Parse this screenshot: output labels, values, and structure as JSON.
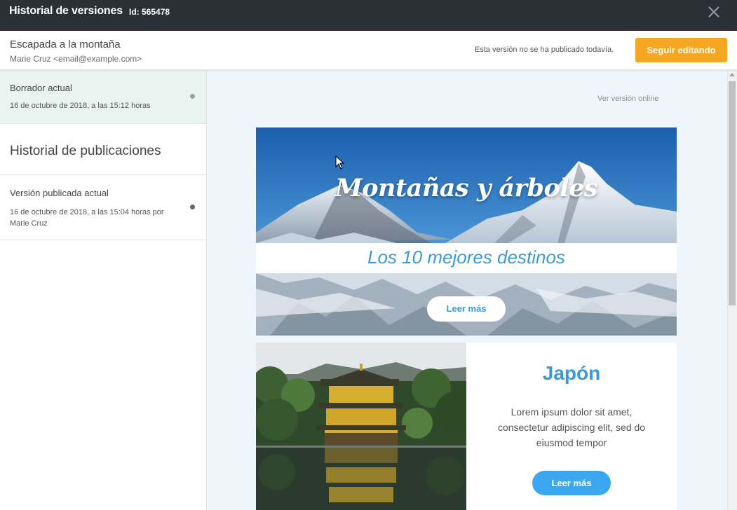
{
  "window": {
    "title": "Historial de versiones",
    "id_label": "Id: 565478"
  },
  "campaign": {
    "name": "Escapada a la montaña",
    "author": "Marie Cruz <email@example.com>",
    "status": "Esta versión no se ha publicado todavía.",
    "edit_button": "Seguir editando"
  },
  "sidebar": {
    "draft": {
      "label": "Borrador actual",
      "date": "16 de octubre de 2018, a las 15:12 horas"
    },
    "history_title": "Historial de publicaciones",
    "published": {
      "label": "Versión publicada actual",
      "date": "16 de octubre de 2018, a las 15:04 horas por Marie Cruz"
    }
  },
  "preview": {
    "online_link": "Ver versión online",
    "hero": {
      "script_title": "Montañas y árboles",
      "subtitle": "Los 10 mejores destinos",
      "button": "Leer más"
    },
    "card": {
      "title": "Japón",
      "body": "Lorem ipsum dolor sit amet, consectetur adipiscing elit, sed do eiusmod tempor",
      "button": "Leer más"
    }
  },
  "colors": {
    "topbar": "#2b2f36",
    "accent_orange": "#f5a623",
    "accent_blue": "#3a9ad9",
    "button_blue": "#3ba7f0",
    "draft_bg": "#e9f4f1",
    "preview_bg": "#eef6fb"
  },
  "icons": {
    "close": "close-icon",
    "draft_status": "dot-icon",
    "published_status": "dot-icon",
    "cursor": "mouse-pointer-icon"
  }
}
